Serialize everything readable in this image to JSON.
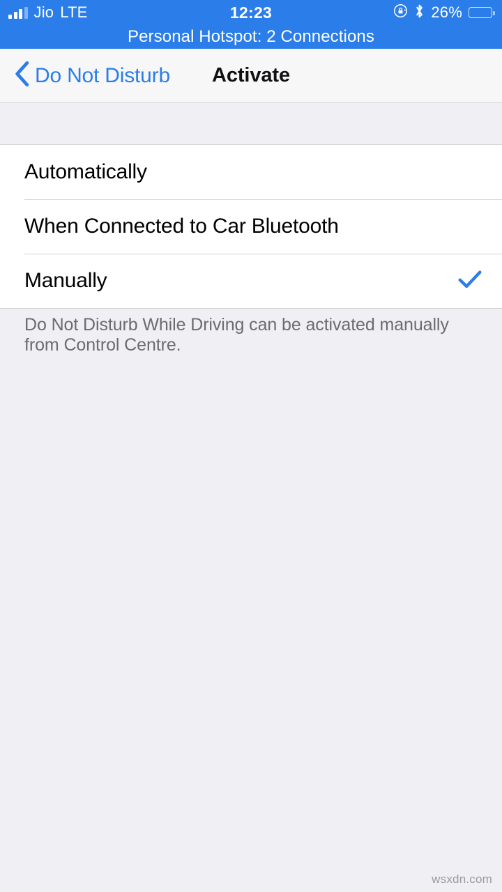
{
  "status_bar": {
    "carrier": "Jio",
    "network_type": "LTE",
    "time": "12:23",
    "battery_percent": "26%",
    "battery_level": 26,
    "icons": [
      "signal-bars-icon",
      "rotation-lock-icon",
      "bluetooth-icon",
      "battery-icon"
    ],
    "hotspot_banner": "Personal Hotspot: 2 Connections",
    "background_color": "#2B7DE9"
  },
  "nav_bar": {
    "back_label": "Do Not Disturb",
    "title": "Activate",
    "tint_color": "#2B7DE9"
  },
  "options": [
    {
      "label": "Automatically",
      "selected": false
    },
    {
      "label": "When Connected to Car Bluetooth",
      "selected": false
    },
    {
      "label": "Manually",
      "selected": true
    }
  ],
  "footer": {
    "text": "Do Not Disturb While Driving can be activated manually from Control Centre."
  },
  "watermark": {
    "text": "wsxdn.com"
  },
  "theme": {
    "group_background": "#EFEFF4",
    "cell_background": "#FFFFFF",
    "separator": "#D3D3D6",
    "accent": "#2B7DE9",
    "footer_text": "#6C6C70"
  }
}
